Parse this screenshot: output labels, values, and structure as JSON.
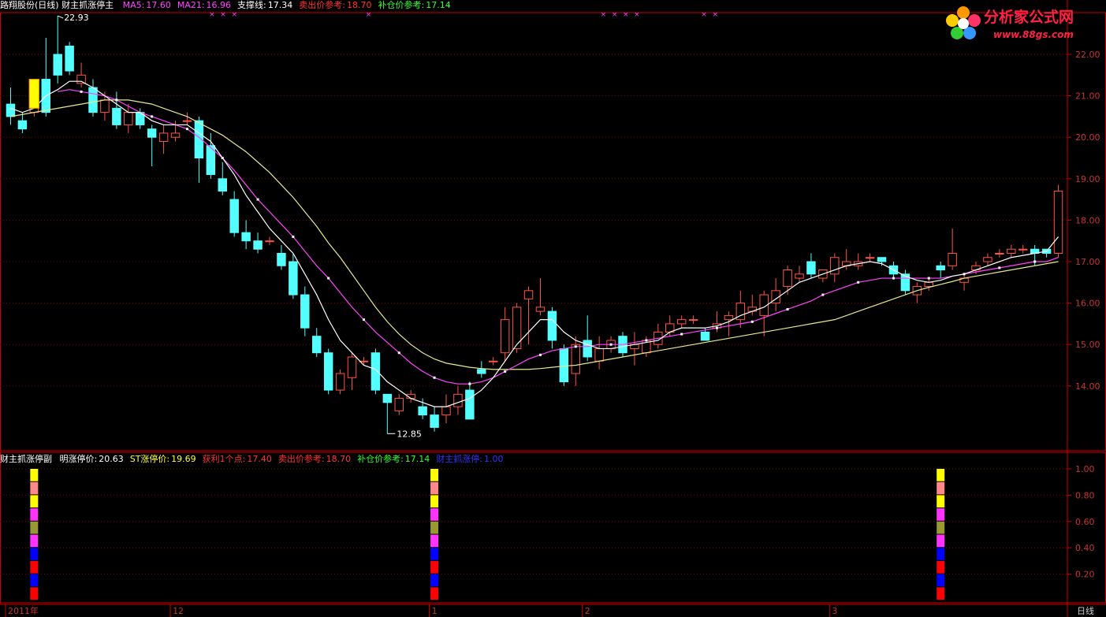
{
  "header_main": {
    "title": "路翔股份(日线) 财主抓涨停主",
    "items": [
      {
        "label": "MA5:",
        "value": "17.60",
        "color": "#ff44ff"
      },
      {
        "label": "MA21:",
        "value": "16.96",
        "color": "#ff44ff"
      },
      {
        "label": "支撑线:",
        "value": "17.34",
        "color": "#ffffff"
      },
      {
        "label": "卖出价参考:",
        "value": "18.70",
        "color": "#ff3333"
      },
      {
        "label": "补仓价参考:",
        "value": "17.14",
        "color": "#33ff33"
      }
    ]
  },
  "header_sub": {
    "title": "财主抓涨停副",
    "items": [
      {
        "label": "明涨停价:",
        "value": "20.63",
        "color": "#ffffff"
      },
      {
        "label": "ST涨停价:",
        "value": "19.69",
        "color": "#ffff44"
      },
      {
        "label": "获利1个点:",
        "value": "17.40",
        "color": "#ff3333"
      },
      {
        "label": "卖出价参考:",
        "value": "18.70",
        "color": "#ff3333"
      },
      {
        "label": "补仓价参考:",
        "value": "17.14",
        "color": "#33ff33"
      },
      {
        "label": "财主抓涨停:",
        "value": "1.00",
        "color": "#3333ff"
      }
    ]
  },
  "logo": {
    "text": "分析家公式网",
    "url": "www.88gs.com"
  },
  "period_label": "日线",
  "annotations": {
    "high": "22.93",
    "low": "12.85"
  },
  "colors": {
    "up": "#ff5544",
    "down": "#54ffff",
    "grid": "#880000",
    "axis": "#cc0000"
  },
  "chart_data": [
    {
      "type": "candlestick",
      "ylim": [
        12.7,
        22.3
      ],
      "y_ticks": [
        "22.00",
        "21.00",
        "20.00",
        "19.00",
        "18.00",
        "17.00",
        "16.00",
        "15.00",
        "14.00"
      ],
      "x_ticks": [
        {
          "label": "2011年",
          "index": 0
        },
        {
          "label": "12",
          "index": 14
        },
        {
          "label": "1",
          "index": 36
        },
        {
          "label": "2",
          "index": 49
        },
        {
          "label": "3",
          "index": 70
        }
      ],
      "candles": [
        [
          20.8,
          20.5,
          21.2,
          20.3
        ],
        [
          20.4,
          20.2,
          20.6,
          20.1
        ],
        [
          20.6,
          21.3,
          21.4,
          20.5
        ],
        [
          21.4,
          20.6,
          22.4,
          20.5
        ],
        [
          22.0,
          21.5,
          22.93,
          21.3
        ],
        [
          22.2,
          21.6,
          22.3,
          21.5
        ],
        [
          21.3,
          21.5,
          21.8,
          21.2
        ],
        [
          21.2,
          20.6,
          21.4,
          20.5
        ],
        [
          20.6,
          20.9,
          21.1,
          20.4
        ],
        [
          20.7,
          20.3,
          21.1,
          20.2
        ],
        [
          20.3,
          20.6,
          20.8,
          20.1
        ],
        [
          20.6,
          20.3,
          20.7,
          20.2
        ],
        [
          20.2,
          20.0,
          20.3,
          19.3
        ],
        [
          19.9,
          20.1,
          20.3,
          19.6
        ],
        [
          20.0,
          20.1,
          20.4,
          19.9
        ],
        [
          20.4,
          20.4,
          20.6,
          20.3
        ],
        [
          20.4,
          19.5,
          20.5,
          18.9
        ],
        [
          19.8,
          19.1,
          20.1,
          19.0
        ],
        [
          19.0,
          18.7,
          19.4,
          18.6
        ],
        [
          18.5,
          17.7,
          18.7,
          17.6
        ],
        [
          17.7,
          17.5,
          18.0,
          17.3
        ],
        [
          17.5,
          17.3,
          17.7,
          17.2
        ],
        [
          17.5,
          17.5,
          17.6,
          17.4
        ],
        [
          17.2,
          16.9,
          17.4,
          16.8
        ],
        [
          17.0,
          16.2,
          17.2,
          16.1
        ],
        [
          16.2,
          15.4,
          16.4,
          15.2
        ],
        [
          15.2,
          14.8,
          15.4,
          14.7
        ],
        [
          14.8,
          13.9,
          14.9,
          13.8
        ],
        [
          13.9,
          14.3,
          14.4,
          13.8
        ],
        [
          14.2,
          14.7,
          14.8,
          13.9
        ],
        [
          14.6,
          14.6,
          14.7,
          14.5
        ],
        [
          14.8,
          13.9,
          14.9,
          13.8
        ],
        [
          13.8,
          13.6,
          13.8,
          12.85
        ],
        [
          13.4,
          13.7,
          13.8,
          13.3
        ],
        [
          13.7,
          13.8,
          13.9,
          13.6
        ],
        [
          13.5,
          13.3,
          13.7,
          13.2
        ],
        [
          13.3,
          13.0,
          13.5,
          12.9
        ],
        [
          13.3,
          13.5,
          13.8,
          13.1
        ],
        [
          13.5,
          13.8,
          14.0,
          13.3
        ],
        [
          13.9,
          13.2,
          14.1,
          13.2
        ],
        [
          14.4,
          14.3,
          14.6,
          14.2
        ],
        [
          14.6,
          14.6,
          14.7,
          14.5
        ],
        [
          14.8,
          15.6,
          15.9,
          14.6
        ],
        [
          14.9,
          15.9,
          16.0,
          14.8
        ],
        [
          16.1,
          16.3,
          16.4,
          15.0
        ],
        [
          15.8,
          15.9,
          16.6,
          15.7
        ],
        [
          15.8,
          15.1,
          15.9,
          14.9
        ],
        [
          14.9,
          14.1,
          15.0,
          14.0
        ],
        [
          14.3,
          15.0,
          15.2,
          14.0
        ],
        [
          15.1,
          14.7,
          15.7,
          14.6
        ],
        [
          14.6,
          14.9,
          15.2,
          14.4
        ],
        [
          14.9,
          15.1,
          15.2,
          14.8
        ],
        [
          15.2,
          14.8,
          15.3,
          14.7
        ],
        [
          14.9,
          15.0,
          15.3,
          14.5
        ],
        [
          14.8,
          15.1,
          15.2,
          14.7
        ],
        [
          15.0,
          15.3,
          15.5,
          14.9
        ],
        [
          15.3,
          15.5,
          15.7,
          15.2
        ],
        [
          15.5,
          15.6,
          15.7,
          15.4
        ],
        [
          15.6,
          15.6,
          15.7,
          15.5
        ],
        [
          15.3,
          15.1,
          15.4,
          15.1
        ],
        [
          15.4,
          15.5,
          15.8,
          15.3
        ],
        [
          15.6,
          15.7,
          15.8,
          15.2
        ],
        [
          15.6,
          16.0,
          16.3,
          15.4
        ],
        [
          15.8,
          15.9,
          16.2,
          15.7
        ],
        [
          15.7,
          16.2,
          16.3,
          15.2
        ],
        [
          16.0,
          16.3,
          16.6,
          15.8
        ],
        [
          16.4,
          16.8,
          16.9,
          16.2
        ],
        [
          16.6,
          16.7,
          16.9,
          16.5
        ],
        [
          17.0,
          16.7,
          17.2,
          16.6
        ],
        [
          16.6,
          16.8,
          16.8,
          16.5
        ],
        [
          16.7,
          17.1,
          17.2,
          16.5
        ],
        [
          16.9,
          17.0,
          17.3,
          16.8
        ],
        [
          16.9,
          17.0,
          17.2,
          16.8
        ],
        [
          17.1,
          17.1,
          17.2,
          17.0
        ],
        [
          17.1,
          17.0,
          17.1,
          16.9
        ],
        [
          16.9,
          16.7,
          17.0,
          16.6
        ],
        [
          16.7,
          16.3,
          16.8,
          16.2
        ],
        [
          16.2,
          16.4,
          16.5,
          16.0
        ],
        [
          16.4,
          16.5,
          16.6,
          16.3
        ],
        [
          16.9,
          16.8,
          17.0,
          16.6
        ],
        [
          16.9,
          17.2,
          17.8,
          16.8
        ],
        [
          16.5,
          16.6,
          16.7,
          16.3
        ],
        [
          16.8,
          16.9,
          17.0,
          16.7
        ],
        [
          17.0,
          17.1,
          17.2,
          16.9
        ],
        [
          17.2,
          17.2,
          17.3,
          17.1
        ],
        [
          17.2,
          17.3,
          17.4,
          17.1
        ],
        [
          17.3,
          17.3,
          17.4,
          17.2
        ],
        [
          17.3,
          17.2,
          17.4,
          16.9
        ],
        [
          17.3,
          17.2,
          17.3,
          17.1
        ],
        [
          17.2,
          18.7,
          18.85,
          17.1
        ]
      ],
      "ma5": [
        20.7,
        20.6,
        20.7,
        21.0,
        21.15,
        21.35,
        21.35,
        21.2,
        21.0,
        20.8,
        20.6,
        20.6,
        20.4,
        20.3,
        20.3,
        20.3,
        20.1,
        19.9,
        19.5,
        19.1,
        18.6,
        18.2,
        17.8,
        17.5,
        17.2,
        16.7,
        16.2,
        15.6,
        15.1,
        14.8,
        14.5,
        14.4,
        14.1,
        13.9,
        13.7,
        13.6,
        13.5,
        13.5,
        13.6,
        13.7,
        13.9,
        14.2,
        14.6,
        15.0,
        15.3,
        15.6,
        15.6,
        15.3,
        15.1,
        15.0,
        14.9,
        14.9,
        14.95,
        15.0,
        15.05,
        15.1,
        15.3,
        15.4,
        15.4,
        15.4,
        15.45,
        15.55,
        15.7,
        15.8,
        15.9,
        16.1,
        16.3,
        16.5,
        16.6,
        16.7,
        16.8,
        16.9,
        16.95,
        17.0,
        16.95,
        16.8,
        16.65,
        16.55,
        16.5,
        16.55,
        16.65,
        16.7,
        16.8,
        16.9,
        17.0,
        17.1,
        17.15,
        17.2,
        17.25,
        17.6
      ],
      "ma21": [
        null,
        null,
        null,
        null,
        21.1,
        21.15,
        21.1,
        21.05,
        21.0,
        20.9,
        20.75,
        20.6,
        20.5,
        20.4,
        20.3,
        20.2,
        20.0,
        19.75,
        19.5,
        19.2,
        18.85,
        18.5,
        18.2,
        17.9,
        17.6,
        17.25,
        16.9,
        16.6,
        16.25,
        15.9,
        15.6,
        15.3,
        15.05,
        14.8,
        14.55,
        14.35,
        14.2,
        14.1,
        14.05,
        14.05,
        14.1,
        14.2,
        14.35,
        14.5,
        14.65,
        14.75,
        14.85,
        14.9,
        14.95,
        14.95,
        15.0,
        15.0,
        15.0,
        15.05,
        15.1,
        15.15,
        15.2,
        15.25,
        15.3,
        15.35,
        15.4,
        15.45,
        15.5,
        15.55,
        15.65,
        15.75,
        15.85,
        15.95,
        16.05,
        16.2,
        16.3,
        16.4,
        16.5,
        16.55,
        16.6,
        16.6,
        16.6,
        16.6,
        16.6,
        16.6,
        16.65,
        16.7,
        16.75,
        16.8,
        16.85,
        16.9,
        16.95,
        17.0,
        17.0,
        17.1
      ],
      "support": [
        20.5,
        20.55,
        20.6,
        20.65,
        20.7,
        20.75,
        20.8,
        20.85,
        20.9,
        20.9,
        20.9,
        20.85,
        20.8,
        20.7,
        20.6,
        20.5,
        20.35,
        20.2,
        20.05,
        19.85,
        19.65,
        19.4,
        19.15,
        18.85,
        18.55,
        18.2,
        17.85,
        17.45,
        17.1,
        16.7,
        16.3,
        15.9,
        15.55,
        15.25,
        15.0,
        14.8,
        14.65,
        14.55,
        14.5,
        14.45,
        14.42,
        14.4,
        14.4,
        14.4,
        14.4,
        14.42,
        14.45,
        14.48,
        14.5,
        14.55,
        14.6,
        14.65,
        14.7,
        14.75,
        14.8,
        14.85,
        14.9,
        14.95,
        15.0,
        15.05,
        15.1,
        15.15,
        15.2,
        15.25,
        15.3,
        15.35,
        15.4,
        15.45,
        15.5,
        15.55,
        15.6,
        15.7,
        15.8,
        15.9,
        16.0,
        16.1,
        16.2,
        16.3,
        16.38,
        16.45,
        16.52,
        16.6,
        16.65,
        16.7,
        16.75,
        16.8,
        16.85,
        16.9,
        16.95,
        17.0
      ],
      "marker_points": [
        3,
        4,
        5,
        17,
        38,
        39,
        40,
        41,
        47,
        48,
        75
      ]
    },
    {
      "type": "bar",
      "ylim": [
        0,
        1.1
      ],
      "y_ticks": [
        "1.00",
        "0.80",
        "0.60",
        "0.40",
        "0.20"
      ],
      "signal_indices": [
        2,
        36,
        79
      ],
      "signal_value": 1.0,
      "bar_colors": [
        "#ffff00",
        "#ff8888",
        "#ffff00",
        "#ff33ff",
        "#999933",
        "#ff33ff",
        "#0000ff",
        "#ff0000",
        "#0000ff",
        "#ff0000"
      ]
    }
  ]
}
